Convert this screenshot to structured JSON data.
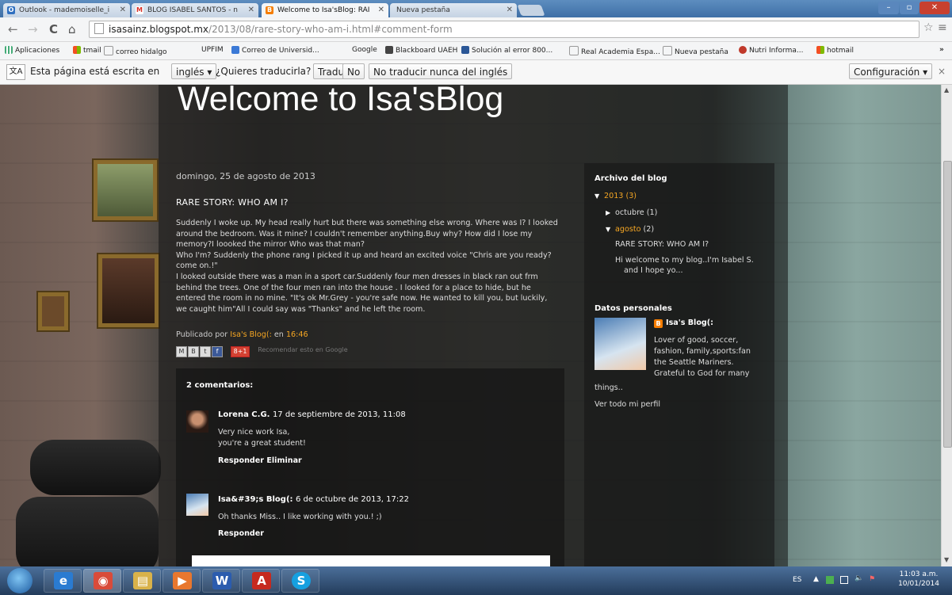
{
  "tabs": [
    {
      "title": "Outlook - mademoiselle_i",
      "icon": "outlook-icon",
      "color": "#2e6fc0"
    },
    {
      "title": "BLOG ISABEL SANTOS - n",
      "icon": "gmail-icon",
      "color": "#d93025"
    },
    {
      "title": "Welcome to Isa'sBlog: RAI",
      "icon": "blogger-icon",
      "color": "#f57d00"
    },
    {
      "title": "Nueva pestaña",
      "icon": "",
      "color": ""
    }
  ],
  "address": {
    "host": "isasainz.blogspot.mx",
    "path": "/2013/08/rare-story-who-am-i.html#comment-form"
  },
  "bookmarks": [
    "Aplicaciones",
    "tmail",
    "correo hidalgo",
    "UPFIM",
    "Correo de Universid...",
    "Google",
    "Blackboard UAEH",
    "Solución al error 800...",
    "Real Academia Espa...",
    "Nueva pestaña",
    "Nutri Informa...",
    "hotmail"
  ],
  "translate": {
    "prefix": "Esta página está escrita en",
    "language": "inglés",
    "question": "¿Quieres traducirla?",
    "translate_btn": "Traducir",
    "no_btn": "No",
    "never_btn": "No traducir nunca del inglés",
    "settings_btn": "Configuración"
  },
  "blog": {
    "title": "Welcome to Isa'sBlog",
    "post_date": "domingo, 25 de agosto de 2013",
    "post_title": "RARE STORY: WHO AM I?",
    "post_body": [
      "Suddenly I woke up. My head really hurt but there was something else wrong. Where was I? I looked",
      "around the bedroom. Was it mine? I couldn't remember anything.Buy why? How did I lose my",
      "memory?I loooked the mirror Who was that man?",
      "Who I'm? Suddenly the phone rang I picked it up and heard an excited voice \"Chris are you ready?",
      "come on.!\"",
      "I looked outside there was a man in a sport car.Suddenly four men dresses in black ran out frm",
      "behind the trees. One of the four men ran into the house . I looked for a place to hide, but he",
      "entered the room in no mine. \"It's ok Mr.Grey - you're safe now. He wanted to kill you, but luckily,",
      "we caught him\"All I could say was \"Thanks\" and he left the room."
    ],
    "published_by": "Publicado por",
    "author": "Isa's Blog(:",
    "published_at_label": "en",
    "published_time": "16:46",
    "share_note": "Recomendar esto en Google",
    "comments_heading": "2 comentarios:",
    "comments": [
      {
        "author": "Lorena C.G.",
        "date": "17 de septiembre de 2013, 11:08",
        "text": [
          "Very nice work Isa,",
          "you're a great student!"
        ],
        "actions": "Responder Eliminar"
      },
      {
        "author": "Isa&#39;s Blog(:",
        "date": "6 de octubre de 2013, 17:22",
        "text": [
          "Oh thanks Miss.. I like working with you.! ;)"
        ],
        "actions": "Responder"
      }
    ]
  },
  "sidebar": {
    "archive_title": "Archivo del blog",
    "year": "2013 (3)",
    "month_oct": "octubre (1)",
    "month_aug": "agosto",
    "month_aug_count": "(2)",
    "post_link": "RARE STORY: WHO AM I?",
    "post_snippet_1": "Hi welcome to my blog..I'm Isabel S.",
    "post_snippet_2": "and I hope yo...",
    "profile_title": "Datos personales",
    "profile_name": "Isa's Blog(:",
    "profile_about": [
      "Lover of good, soccer,",
      "fashion, family,sports:fan",
      "the Seattle Mariners.",
      "Grateful to God for many"
    ],
    "profile_about_last": "things..",
    "profile_link": "Ver todo mi perfil"
  },
  "taskbar": {
    "apps": [
      {
        "name": "internet-explorer",
        "glyph": "e",
        "color": "#2a7bd1"
      },
      {
        "name": "chrome",
        "glyph": "◉",
        "color": "#d94b3a"
      },
      {
        "name": "file-explorer",
        "glyph": "▤",
        "color": "#d9b24a"
      },
      {
        "name": "media-player",
        "glyph": "▶",
        "color": "#e8772e"
      },
      {
        "name": "word",
        "glyph": "W",
        "color": "#2b5cae"
      },
      {
        "name": "acrobat",
        "glyph": "A",
        "color": "#c62a1f"
      },
      {
        "name": "skype",
        "glyph": "S",
        "color": "#16a0e0"
      }
    ],
    "lang": "ES",
    "time": "11:03 a.m.",
    "date": "10/01/2014"
  }
}
